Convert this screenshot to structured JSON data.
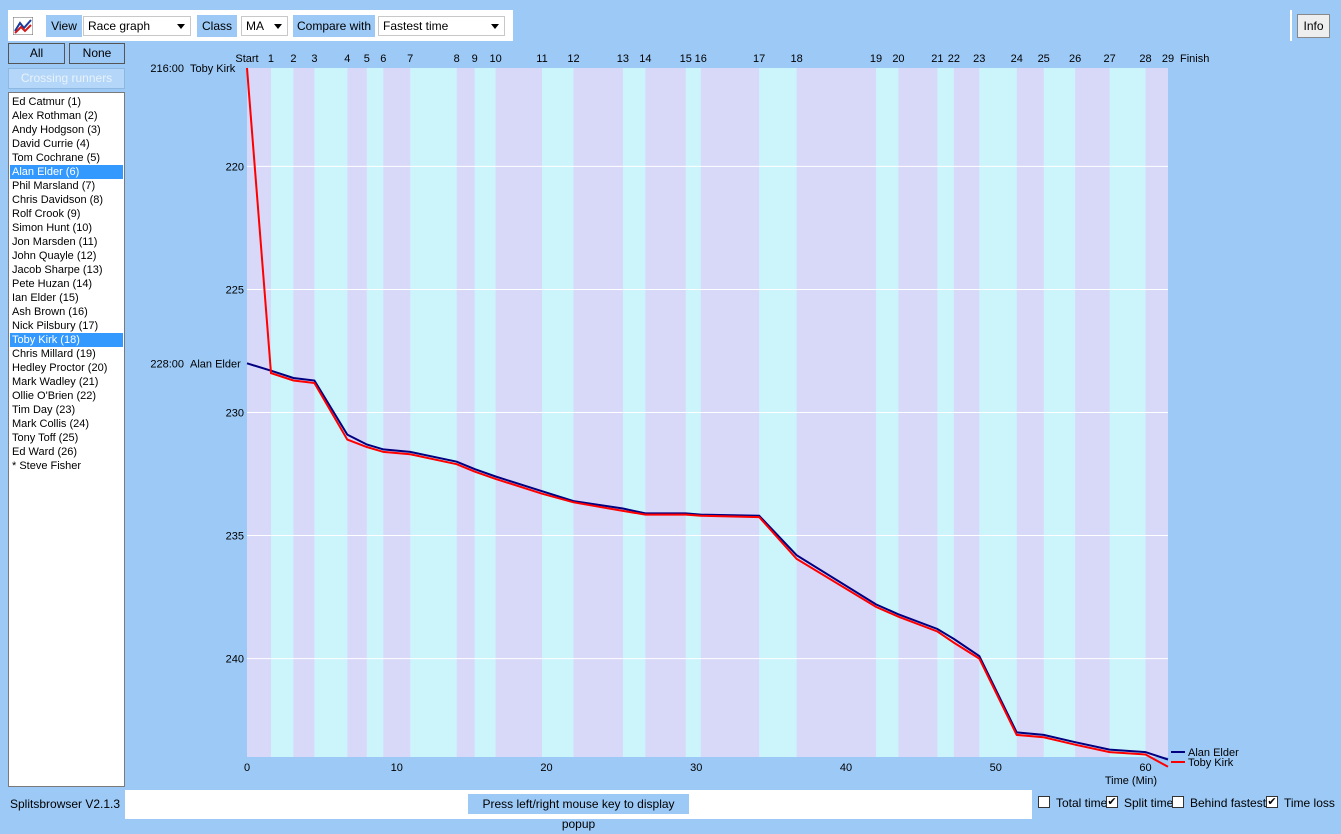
{
  "toolbar": {
    "view_label": "View",
    "view_value": "Race graph",
    "class_label": "Class",
    "class_value": "MA",
    "compare_label": "Compare with",
    "compare_value": "Fastest time",
    "info_label": "Info",
    "logo_icon": "splitsbrowser-logo-icon"
  },
  "buttons": {
    "all": "All",
    "none": "None",
    "crossing": "Crossing runners"
  },
  "runners": [
    {
      "label": "Ed Catmur  (1)",
      "selected": false
    },
    {
      "label": "Alex Rothman  (2)",
      "selected": false
    },
    {
      "label": "Andy Hodgson  (3)",
      "selected": false
    },
    {
      "label": "David Currie  (4)",
      "selected": false
    },
    {
      "label": "Tom Cochrane  (5)",
      "selected": false
    },
    {
      "label": "Alan Elder  (6)",
      "selected": true
    },
    {
      "label": "Phil Marsland  (7)",
      "selected": false
    },
    {
      "label": "Chris Davidson  (8)",
      "selected": false
    },
    {
      "label": "Rolf Crook  (9)",
      "selected": false
    },
    {
      "label": "Simon Hunt  (10)",
      "selected": false
    },
    {
      "label": "Jon Marsden  (11)",
      "selected": false
    },
    {
      "label": "John Quayle  (12)",
      "selected": false
    },
    {
      "label": "Jacob Sharpe  (13)",
      "selected": false
    },
    {
      "label": "Pete Huzan  (14)",
      "selected": false
    },
    {
      "label": "Ian Elder  (15)",
      "selected": false
    },
    {
      "label": "Ash Brown  (16)",
      "selected": false
    },
    {
      "label": "Nick Pilsbury  (17)",
      "selected": false
    },
    {
      "label": "Toby Kirk  (18)",
      "selected": true
    },
    {
      "label": "Chris Millard  (19)",
      "selected": false
    },
    {
      "label": "Hedley Proctor  (20)",
      "selected": false
    },
    {
      "label": "Mark Wadley  (21)",
      "selected": false
    },
    {
      "label": "Ollie O'Brien  (22)",
      "selected": false
    },
    {
      "label": "Tim Day  (23)",
      "selected": false
    },
    {
      "label": "Mark Collis  (24)",
      "selected": false
    },
    {
      "label": "Tony Toff  (25)",
      "selected": false
    },
    {
      "label": "Ed Ward  (26)",
      "selected": false
    },
    {
      "label": "* Steve Fisher",
      "selected": false
    }
  ],
  "status": {
    "version": "Splitsbrowser V2.1.3",
    "message": "Press left/right mouse key to display popup",
    "options": [
      {
        "label": "Total time",
        "checked": false
      },
      {
        "label": "Split time",
        "checked": true
      },
      {
        "label": "Behind fastest",
        "checked": false
      },
      {
        "label": "Time loss",
        "checked": true
      }
    ]
  },
  "chart_data": {
    "type": "line",
    "title": "",
    "xlabel": "Time (Min)",
    "ylabel": "",
    "xlim": [
      0,
      61.5
    ],
    "ylim": [
      216,
      244
    ],
    "x_ticks": [
      0,
      10,
      20,
      30,
      40,
      50,
      60
    ],
    "y_ticks": [
      220,
      225,
      230,
      235,
      240
    ],
    "grid": true,
    "colors": {
      "plot_bg": "#ccf5fb",
      "band_alt": "#d8d8f9",
      "panel": "#9cc9f6",
      "alan": "#000080",
      "toby": "#ff0000"
    },
    "controls": [
      {
        "label": "Start",
        "x": 0
      },
      {
        "label": "1",
        "x": 1.6
      },
      {
        "label": "2",
        "x": 3.1
      },
      {
        "label": "3",
        "x": 4.5
      },
      {
        "label": "4",
        "x": 6.7
      },
      {
        "label": "5",
        "x": 8.0
      },
      {
        "label": "6",
        "x": 9.1
      },
      {
        "label": "7",
        "x": 10.9
      },
      {
        "label": "8",
        "x": 14.0
      },
      {
        "label": "9",
        "x": 15.2
      },
      {
        "label": "10",
        "x": 16.6
      },
      {
        "label": "11",
        "x": 19.7
      },
      {
        "label": "12",
        "x": 21.8
      },
      {
        "label": "13",
        "x": 25.1
      },
      {
        "label": "14",
        "x": 26.6
      },
      {
        "label": "15",
        "x": 29.3
      },
      {
        "label": "16",
        "x": 30.3
      },
      {
        "label": "17",
        "x": 34.2
      },
      {
        "label": "18",
        "x": 36.7
      },
      {
        "label": "19",
        "x": 42.0
      },
      {
        "label": "20",
        "x": 43.5
      },
      {
        "label": "21",
        "x": 46.1
      },
      {
        "label": "22",
        "x": 47.2
      },
      {
        "label": "23",
        "x": 48.9
      },
      {
        "label": "24",
        "x": 51.4
      },
      {
        "label": "25",
        "x": 53.2
      },
      {
        "label": "26",
        "x": 55.3
      },
      {
        "label": "27",
        "x": 57.6
      },
      {
        "label": "28",
        "x": 60.0
      },
      {
        "label": "29",
        "x": 61.5
      },
      {
        "label": "Finish",
        "x": 61.5
      }
    ],
    "top_labels": [
      {
        "time": "216:00",
        "name": "Toby Kirk",
        "y": 216
      },
      {
        "time": "228:00",
        "name": "Alan Elder",
        "y": 228
      }
    ],
    "series": [
      {
        "name": "Alan Elder",
        "color": "#000080",
        "points": [
          [
            0,
            228.0
          ],
          [
            1.6,
            228.3
          ],
          [
            3.1,
            228.6
          ],
          [
            4.5,
            228.7
          ],
          [
            6.7,
            230.9
          ],
          [
            8.0,
            231.3
          ],
          [
            9.1,
            231.5
          ],
          [
            10.9,
            231.6
          ],
          [
            14.0,
            232.0
          ],
          [
            15.2,
            232.3
          ],
          [
            16.6,
            232.6
          ],
          [
            19.7,
            233.2
          ],
          [
            21.8,
            233.6
          ],
          [
            25.1,
            233.9
          ],
          [
            26.6,
            234.1
          ],
          [
            29.3,
            234.1
          ],
          [
            30.3,
            234.15
          ],
          [
            34.2,
            234.2
          ],
          [
            36.7,
            235.8
          ],
          [
            42.0,
            237.8
          ],
          [
            43.5,
            238.2
          ],
          [
            46.1,
            238.8
          ],
          [
            47.2,
            239.2
          ],
          [
            48.9,
            239.9
          ],
          [
            51.4,
            243.0
          ],
          [
            53.2,
            243.1
          ],
          [
            55.3,
            243.4
          ],
          [
            57.6,
            243.7
          ],
          [
            60.0,
            243.8
          ],
          [
            61.5,
            244.1
          ]
        ]
      },
      {
        "name": "Toby Kirk",
        "color": "#ff0000",
        "points": [
          [
            0,
            216.0
          ],
          [
            1.6,
            228.4
          ],
          [
            3.1,
            228.7
          ],
          [
            4.5,
            228.8
          ],
          [
            6.7,
            231.1
          ],
          [
            8.0,
            231.4
          ],
          [
            9.1,
            231.6
          ],
          [
            10.9,
            231.7
          ],
          [
            14.0,
            232.1
          ],
          [
            15.2,
            232.4
          ],
          [
            16.6,
            232.7
          ],
          [
            19.7,
            233.3
          ],
          [
            21.8,
            233.65
          ],
          [
            25.1,
            234.0
          ],
          [
            26.6,
            234.15
          ],
          [
            29.3,
            234.15
          ],
          [
            30.3,
            234.2
          ],
          [
            34.2,
            234.25
          ],
          [
            36.7,
            235.95
          ],
          [
            42.0,
            237.9
          ],
          [
            43.5,
            238.3
          ],
          [
            46.1,
            238.9
          ],
          [
            47.2,
            239.35
          ],
          [
            48.9,
            240.0
          ],
          [
            51.4,
            243.1
          ],
          [
            53.2,
            243.2
          ],
          [
            55.3,
            243.5
          ],
          [
            57.6,
            243.8
          ],
          [
            60.0,
            243.9
          ],
          [
            61.5,
            244.4
          ]
        ]
      }
    ]
  }
}
